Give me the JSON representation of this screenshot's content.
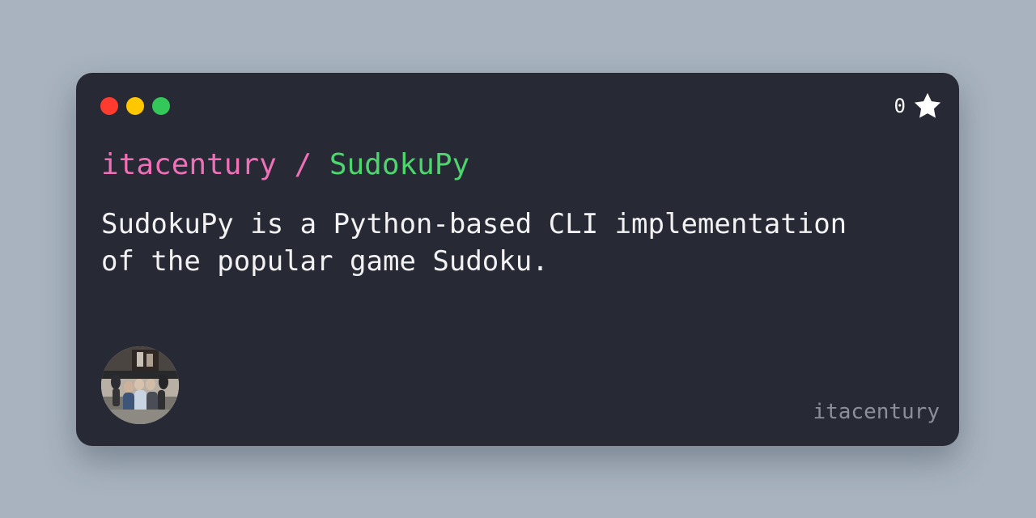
{
  "card": {
    "window_controls": [
      {
        "name": "close",
        "color": "#ff3b30"
      },
      {
        "name": "minimize",
        "color": "#ffc700"
      },
      {
        "name": "maximize",
        "color": "#34c759"
      }
    ],
    "stars": {
      "count": "0",
      "icon": "star-icon"
    },
    "repo": {
      "owner": "itacentury",
      "separator": "/",
      "name": "SudokuPy"
    },
    "description": "SudokuPy is a Python-based CLI implementation of the popular game Sudoku.",
    "avatar": {
      "icon": "user-avatar-photo"
    },
    "username": "itacentury"
  },
  "colors": {
    "background": "#a8b3bf",
    "card": "#272935",
    "owner": "#f070b8",
    "repo": "#4cd66d",
    "text": "#f2f2f2",
    "muted": "#8c8f99"
  }
}
